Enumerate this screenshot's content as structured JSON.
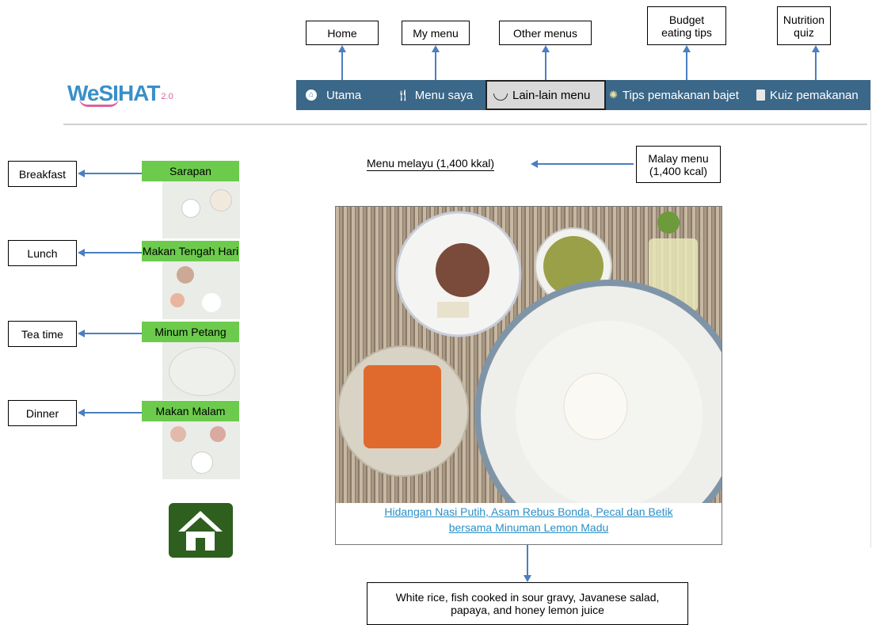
{
  "logo": {
    "text": "WeSIHAT",
    "version": "2.0"
  },
  "nav": {
    "items": [
      {
        "label": "Utama",
        "icon": "home-icon"
      },
      {
        "label": "Menu saya",
        "icon": "fork-knife-icon"
      },
      {
        "label": "Lain-lain menu",
        "icon": "bowl-icon"
      },
      {
        "label": "Tips pemakanan bajet",
        "icon": "lightbulb-icon"
      },
      {
        "label": "Kuiz pemakanan",
        "icon": "document-icon"
      }
    ]
  },
  "top_callouts": [
    "Home",
    "My menu",
    "Other menus",
    "Budget eating tips",
    "Nutrition quiz"
  ],
  "meals": [
    {
      "label": "Sarapan",
      "callout": "Breakfast"
    },
    {
      "label": "Makan Tengah Hari",
      "callout": "Lunch"
    },
    {
      "label": "Minum Petang",
      "callout": "Tea time"
    },
    {
      "label": "Makan Malam",
      "callout": "Dinner"
    }
  ],
  "menu": {
    "title": "Menu melayu (1,400 kkal)",
    "title_callout": "Malay menu (1,400 kcal)",
    "caption_line1": "Hidangan Nasi Putih, Asam Rebus Bonda, Pecal dan Betik",
    "caption_line2": "bersama Minuman Lemon Madu",
    "caption_callout": "White rice, fish cooked in sour gravy, Javanese salad, papaya, and honey lemon juice"
  },
  "colors": {
    "nav_bg": "#3b6788",
    "meal_green": "#6ccb4c",
    "home_button": "#2e5f1f",
    "accent_blue": "#4a7fc0",
    "caption_blue": "#2a8fc6"
  }
}
